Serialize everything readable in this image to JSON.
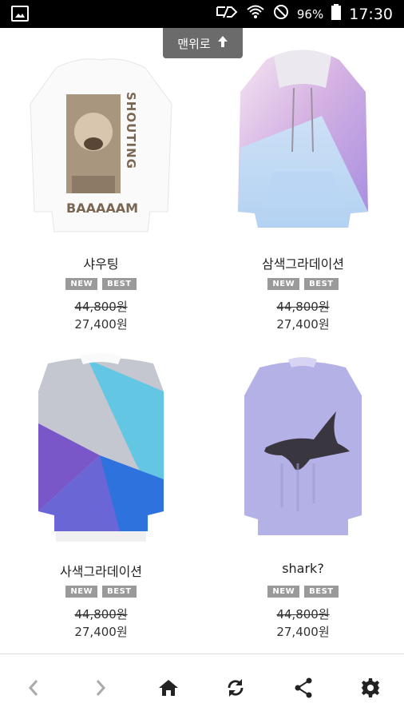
{
  "status_bar": {
    "battery_percent": "96%",
    "time": "17:30"
  },
  "top_button": {
    "label": "맨위로"
  },
  "products": [
    {
      "name": "샤우팅",
      "badges": [
        "NEW",
        "BEST"
      ],
      "price_original": "44,800원",
      "price_sale": "27,400원",
      "image_text": [
        "SHOUTING",
        "BAAAAAM"
      ]
    },
    {
      "name": "삼색그라데이션",
      "badges": [
        "NEW",
        "BEST"
      ],
      "price_original": "44,800원",
      "price_sale": "27,400원"
    },
    {
      "name": "사색그라데이션",
      "badges": [
        "NEW",
        "BEST"
      ],
      "price_original": "44,800원",
      "price_sale": "27,400원"
    },
    {
      "name": "shark?",
      "badges": [
        "NEW",
        "BEST"
      ],
      "price_original": "44,800원",
      "price_sale": "27,400원"
    }
  ],
  "bottom_nav": {
    "icons": [
      "back-icon",
      "forward-icon",
      "home-icon",
      "refresh-icon",
      "share-icon",
      "settings-icon"
    ]
  }
}
